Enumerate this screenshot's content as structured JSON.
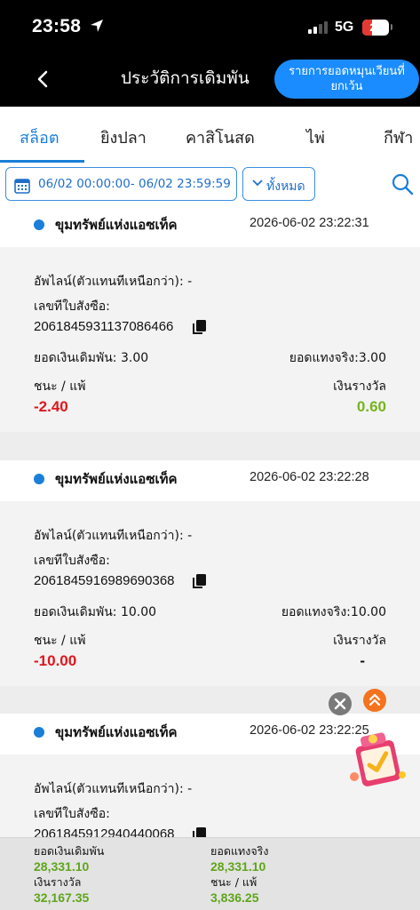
{
  "status": {
    "time": "23:58",
    "network": "5G",
    "battery": "20",
    "battery_level": 0.2
  },
  "header": {
    "title": "ประวัติการเดิมพัน",
    "turnover_button": "รายการยอดหมุนเวียนที่ยกเว้น"
  },
  "tabs": [
    "สล็อต",
    "ยิงปลา",
    "คาสิโนสด",
    "ไพ่",
    "กีฬา"
  ],
  "filter": {
    "date_range": "06/02 00:00:00- 06/02 23:59:59",
    "category": "ทั้งหมด"
  },
  "labels": {
    "agent": "อัพไลน์(ตัวแทนทีเหนือกว่า): -",
    "order_no": "เลขทีใบสังซือ:",
    "bet": "ยอดเงินเดิมพัน:",
    "valid_bet": "ยอดแทงจริง:",
    "win_lose": "ชนะ / แพ้",
    "prize": "เงินรางวัล"
  },
  "records": [
    {
      "game": "ขุมทรัพย์แห่งแอซเท็ค",
      "time": "2026-06-02 23:22:31",
      "order": "2061845931137086466",
      "bet": "3.00",
      "valid": "3.00",
      "winlose": "-2.40",
      "prize": "0.60"
    },
    {
      "game": "ขุมทรัพย์แห่งแอซเท็ค",
      "time": "2026-06-02 23:22:28",
      "order": "2061845916989690368",
      "bet": "10.00",
      "valid": "10.00",
      "winlose": "-10.00",
      "prize": "-"
    },
    {
      "game": "ขุมทรัพย์แห่งแอซเท็ค",
      "time": "2026-06-02 23:22:25",
      "order": "2061845912940440068",
      "bet": "",
      "valid": "",
      "winlose": "",
      "prize": ""
    }
  ],
  "summary": {
    "bet_label": "ยอดเงินเดิมพัน",
    "bet": "28,331.10",
    "valid_label": "ยอดแทงจริง",
    "valid": "28,331.10",
    "prize_label": "เงินรางวัล",
    "prize": "32,167.35",
    "winlose_label": "ชนะ / แพ้",
    "winlose": "3,836.25"
  },
  "colors": {
    "accent": "#1a7fd8",
    "negative": "#e0161d",
    "positive": "#77b41e",
    "pill": "#1a8cff",
    "fab_up": "#f5731e"
  }
}
